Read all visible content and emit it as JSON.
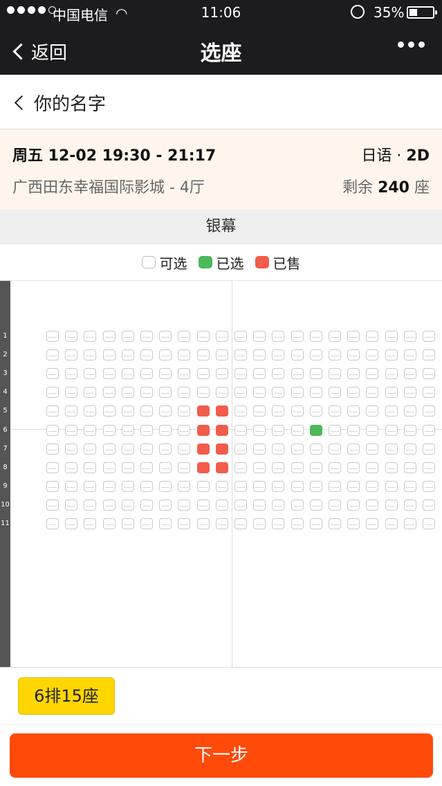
{
  "status_bar": {
    "carrier": "中国电信",
    "time": "11:06",
    "battery": "35%",
    "battery_level": 0.35
  },
  "nav": {
    "back_label": "返回",
    "title": "选座"
  },
  "subheader": {
    "title": "你的名字"
  },
  "showing": {
    "datetime": "周五 12-02 19:30 - 21:17",
    "language": "日语 · ",
    "format": "2D",
    "cinema": "广西田东幸福国际影城 - 4厅",
    "remaining_prefix": "剩余 ",
    "remaining_count": "240",
    "remaining_suffix": " 座"
  },
  "screen_label": "银幕",
  "legend": {
    "available": "可选",
    "selected": "已选",
    "sold": "已售"
  },
  "seat_map": {
    "rows": 11,
    "cols": 21,
    "row_labels": [
      "1",
      "2",
      "3",
      "4",
      "5",
      "6",
      "7",
      "8",
      "9",
      "10",
      "11"
    ],
    "sold": [
      [
        5,
        9
      ],
      [
        5,
        10
      ],
      [
        6,
        9
      ],
      [
        6,
        10
      ],
      [
        7,
        9
      ],
      [
        7,
        10
      ],
      [
        8,
        9
      ],
      [
        8,
        10
      ]
    ],
    "selected": [
      [
        6,
        15
      ]
    ]
  },
  "selected_seat_chip": "6排15座",
  "next_button": "下一步",
  "colors": {
    "sold": "#f25c4c",
    "selected": "#4cb85c",
    "chip": "#ffd600",
    "next": "#ff4a0a"
  }
}
